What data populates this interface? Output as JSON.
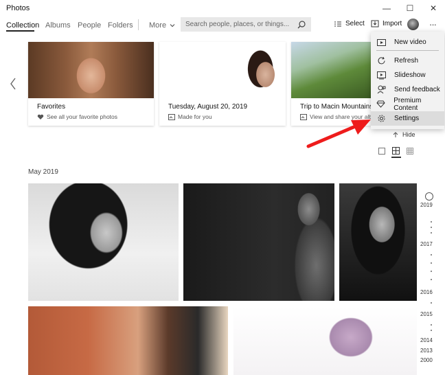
{
  "app": {
    "title": "Photos"
  },
  "window": {
    "minimize_glyph": "—",
    "maximize_glyph": "☐",
    "close_glyph": "✕"
  },
  "nav": {
    "tabs": [
      "Collection",
      "Albums",
      "People",
      "Folders"
    ],
    "more_label": "More",
    "search_placeholder": "Search people, places, or things...",
    "select_label": "Select",
    "import_label": "Import",
    "ellipsis": "···"
  },
  "featured": [
    {
      "title": "Favorites",
      "subtitle": "See all your favorite photos",
      "icon": "heart-icon"
    },
    {
      "title": "Tuesday, August 20, 2019",
      "subtitle": "Made for you",
      "icon": "auto-album-icon"
    },
    {
      "title": "Trip to Macin Mountains",
      "subtitle": "View and share your albu",
      "icon": "album-icon"
    }
  ],
  "menu": {
    "items": [
      {
        "label": "New video",
        "icon": "video-icon"
      },
      {
        "label": "Refresh",
        "icon": "refresh-icon"
      },
      {
        "label": "Slideshow",
        "icon": "slideshow-icon"
      },
      {
        "label": "Send feedback",
        "icon": "feedback-icon"
      },
      {
        "label": "Premium Content",
        "icon": "diamond-icon"
      },
      {
        "label": "Settings",
        "icon": "gear-icon"
      }
    ]
  },
  "hide_label": "Hide",
  "section": {
    "label": "May 2019"
  },
  "timeline": {
    "years": [
      "2019",
      "2017",
      "2016",
      "2015",
      "2014",
      "2013",
      "2000"
    ]
  },
  "colors": {
    "accent": "#222222",
    "menu_bg": "#f2f2f2",
    "highlight": "#dcdcdc",
    "arrow": "#ee1c1c"
  }
}
